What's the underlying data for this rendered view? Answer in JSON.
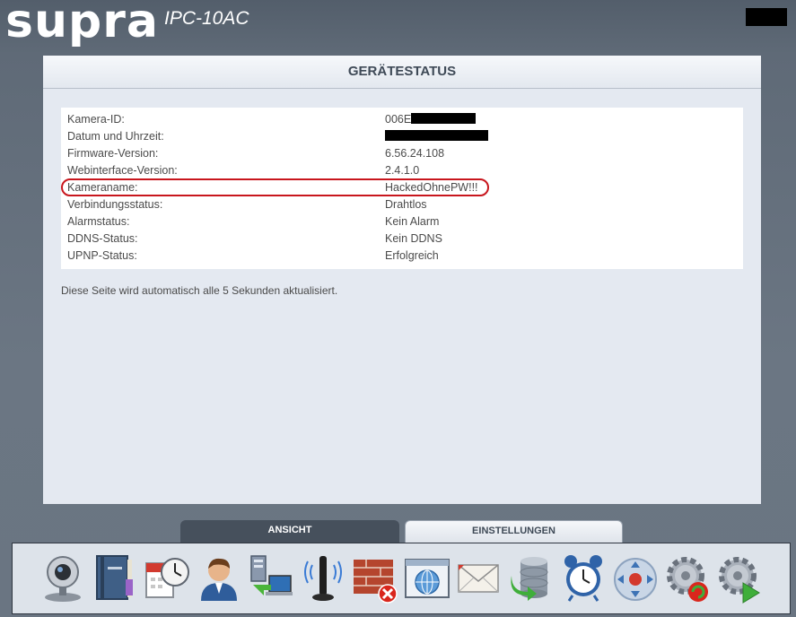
{
  "header": {
    "brand": "supra",
    "model": "IPC-10AC"
  },
  "panel": {
    "title": "GERÄTESTATUS",
    "rows": [
      {
        "label": "Kamera-ID:",
        "value": "006E"
      },
      {
        "label": "Datum und Uhrzeit:",
        "value": ""
      },
      {
        "label": "Firmware-Version:",
        "value": "6.56.24.108"
      },
      {
        "label": "Webinterface-Version:",
        "value": "2.4.1.0"
      },
      {
        "label": "Kameraname:",
        "value": "HackedOhnePW!!!"
      },
      {
        "label": "Verbindungsstatus:",
        "value": "Drahtlos"
      },
      {
        "label": "Alarmstatus:",
        "value": "Kein Alarm"
      },
      {
        "label": "DDNS-Status:",
        "value": "Kein DDNS"
      },
      {
        "label": "UPNP-Status:",
        "value": "Erfolgreich"
      }
    ],
    "note": "Diese Seite wird automatisch alle 5 Sekunden aktualisiert."
  },
  "tabs": {
    "ansicht": "ANSICHT",
    "einstellungen": "EINSTELLUNGEN",
    "active": "einstellungen"
  },
  "toolbar": {
    "icons": [
      "webcam-icon",
      "book-icon",
      "calendar-clock-icon",
      "user-icon",
      "network-icon",
      "wireless-icon",
      "firewall-icon",
      "browser-window-icon",
      "mail-icon",
      "database-icon",
      "alarm-clock-icon",
      "ptz-control-icon",
      "gear-refresh-icon",
      "gear-play-icon"
    ]
  },
  "colors": {
    "highlight": "#c8161d",
    "tab_dark": "#46505c",
    "panel_bg": "#e4e9f1"
  }
}
